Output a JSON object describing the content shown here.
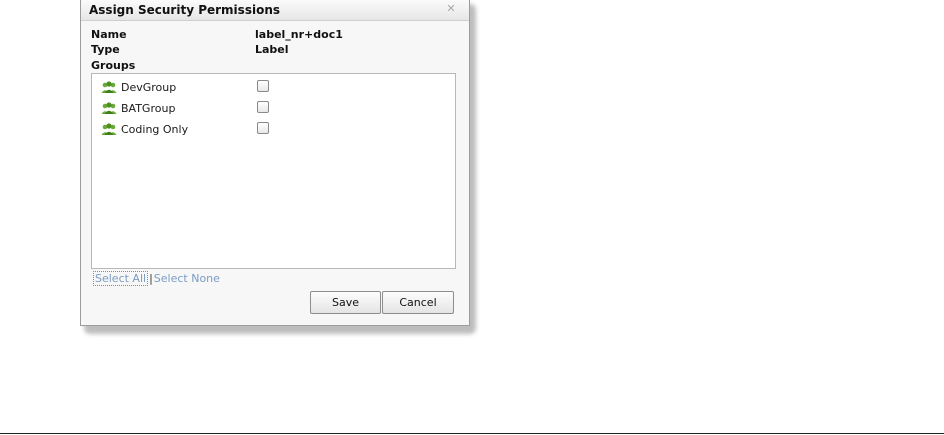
{
  "dialog": {
    "title": "Assign Security Permissions",
    "close_icon": "close-icon"
  },
  "info": {
    "name_label": "Name",
    "name_value": "label_nr+doc1",
    "type_label": "Type",
    "type_value": "Label",
    "groups_label": "Groups"
  },
  "groups": [
    {
      "label": "DevGroup",
      "checked": false,
      "icon": "user-group-icon"
    },
    {
      "label": "BATGroup",
      "checked": false,
      "icon": "user-group-icon"
    },
    {
      "label": "Coding Only",
      "checked": false,
      "icon": "user-group-icon"
    }
  ],
  "selection": {
    "select_all": "Select All",
    "separator": "|",
    "select_none": "Select None"
  },
  "buttons": {
    "save": "Save",
    "cancel": "Cancel"
  },
  "colors": {
    "link": "#7a9cc4",
    "icon_green": "#5a9a2a"
  }
}
